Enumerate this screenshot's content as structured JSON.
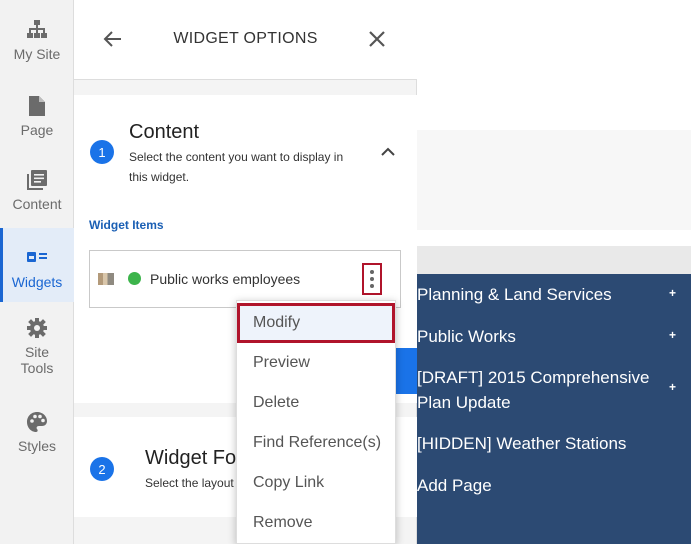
{
  "rail": {
    "items": [
      {
        "label": "My Site",
        "icon": "sitemap-icon"
      },
      {
        "label": "Page",
        "icon": "page-icon"
      },
      {
        "label": "Content",
        "icon": "content-icon"
      },
      {
        "label": "Widgets",
        "icon": "widgets-icon"
      },
      {
        "label": "Site Tools",
        "icon": "gear-icon"
      },
      {
        "label": "Styles",
        "icon": "palette-icon"
      }
    ],
    "site_tools_line1": "Site",
    "site_tools_line2": "Tools",
    "active_color": "#1a66d2"
  },
  "panel": {
    "title": "WIDGET OPTIONS",
    "section1": {
      "number": "1",
      "title": "Content",
      "desc_line1": "Select the content you want to display in",
      "desc_line2": "this widget."
    },
    "widget_items_label": "Widget Items",
    "item": {
      "label": "Public works employees",
      "status_color": "#3cb44b"
    },
    "section2": {
      "number": "2",
      "title": "Widget Fo",
      "desc": "Select the layout"
    }
  },
  "menu": {
    "items": [
      "Modify",
      "Preview",
      "Delete",
      "Find Reference(s)",
      "Copy Link",
      "Remove"
    ],
    "selected": "Modify",
    "highlight_color": "#b0142b"
  },
  "nav": {
    "items": [
      {
        "line1": "Planning & Land Services",
        "line2": "",
        "plus": "+"
      },
      {
        "line1": "Public Works",
        "line2": "",
        "plus": "+"
      },
      {
        "line1": "[DRAFT] 2015 Comprehensive",
        "line2": "Plan Update",
        "plus": "+"
      },
      {
        "line1": "[HIDDEN] Weather Stations",
        "line2": "",
        "plus": ""
      },
      {
        "line1": "Add Page",
        "line2": "",
        "plus": ""
      }
    ],
    "background": "#2c4a73"
  }
}
